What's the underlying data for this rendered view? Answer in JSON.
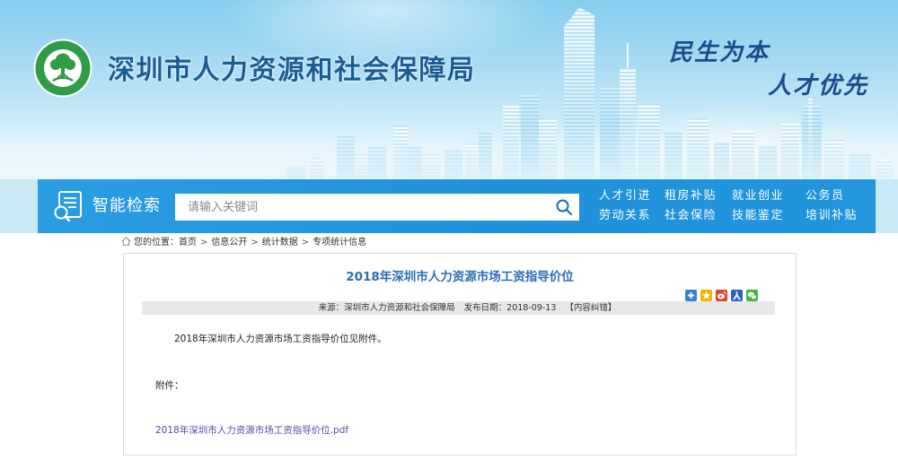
{
  "site": {
    "title": "深圳市人力资源和社会保障局",
    "slogan_1": "民生为本",
    "slogan_2": "人才优先",
    "logo_icon": "bureau-emblem-icon"
  },
  "search": {
    "label": "智能检索",
    "placeholder": "请输入关键词",
    "value": "",
    "icon": "search-icon",
    "label_icon": "document-search-icon"
  },
  "quick_links": {
    "row1": [
      "人才引进",
      "租房补贴",
      "就业创业",
      "公务员"
    ],
    "row2": [
      "劳动关系",
      "社会保险",
      "技能鉴定",
      "培训补贴"
    ]
  },
  "breadcrumb": {
    "label": "您的位置：",
    "items": [
      "首页",
      "信息公开",
      "统计数据",
      "专项统计信息"
    ],
    "separator": ">",
    "icon": "home-icon"
  },
  "article": {
    "title": "2018年深圳市人力资源市场工资指导价位",
    "source_label": "来源：",
    "source": "深圳市人力资源和社会保障局",
    "date_label": "发布日期：",
    "date": "2018-09-13",
    "correction": "【内容纠错】",
    "body": "2018年深圳市人力资源市场工资指导价位见附件。",
    "attachment_label": "附件：",
    "attachment_link": "2018年深圳市人力资源市场工资指导价位.pdf"
  },
  "share_icons": [
    {
      "icon": "share-plus-icon",
      "color": "#3b7fd4"
    },
    {
      "icon": "qzone-icon",
      "color": "#f2b600"
    },
    {
      "icon": "weibo-icon",
      "color": "#e1442b"
    },
    {
      "icon": "renren-icon",
      "color": "#2a63c6"
    },
    {
      "icon": "wechat-icon",
      "color": "#3cb83c"
    }
  ],
  "colors": {
    "search_band": "#1f91da",
    "site_title": "#1a5d96",
    "article_title": "#2b6db8",
    "attachment_link": "#5e44a6",
    "logo_green": "#2f9d45"
  }
}
